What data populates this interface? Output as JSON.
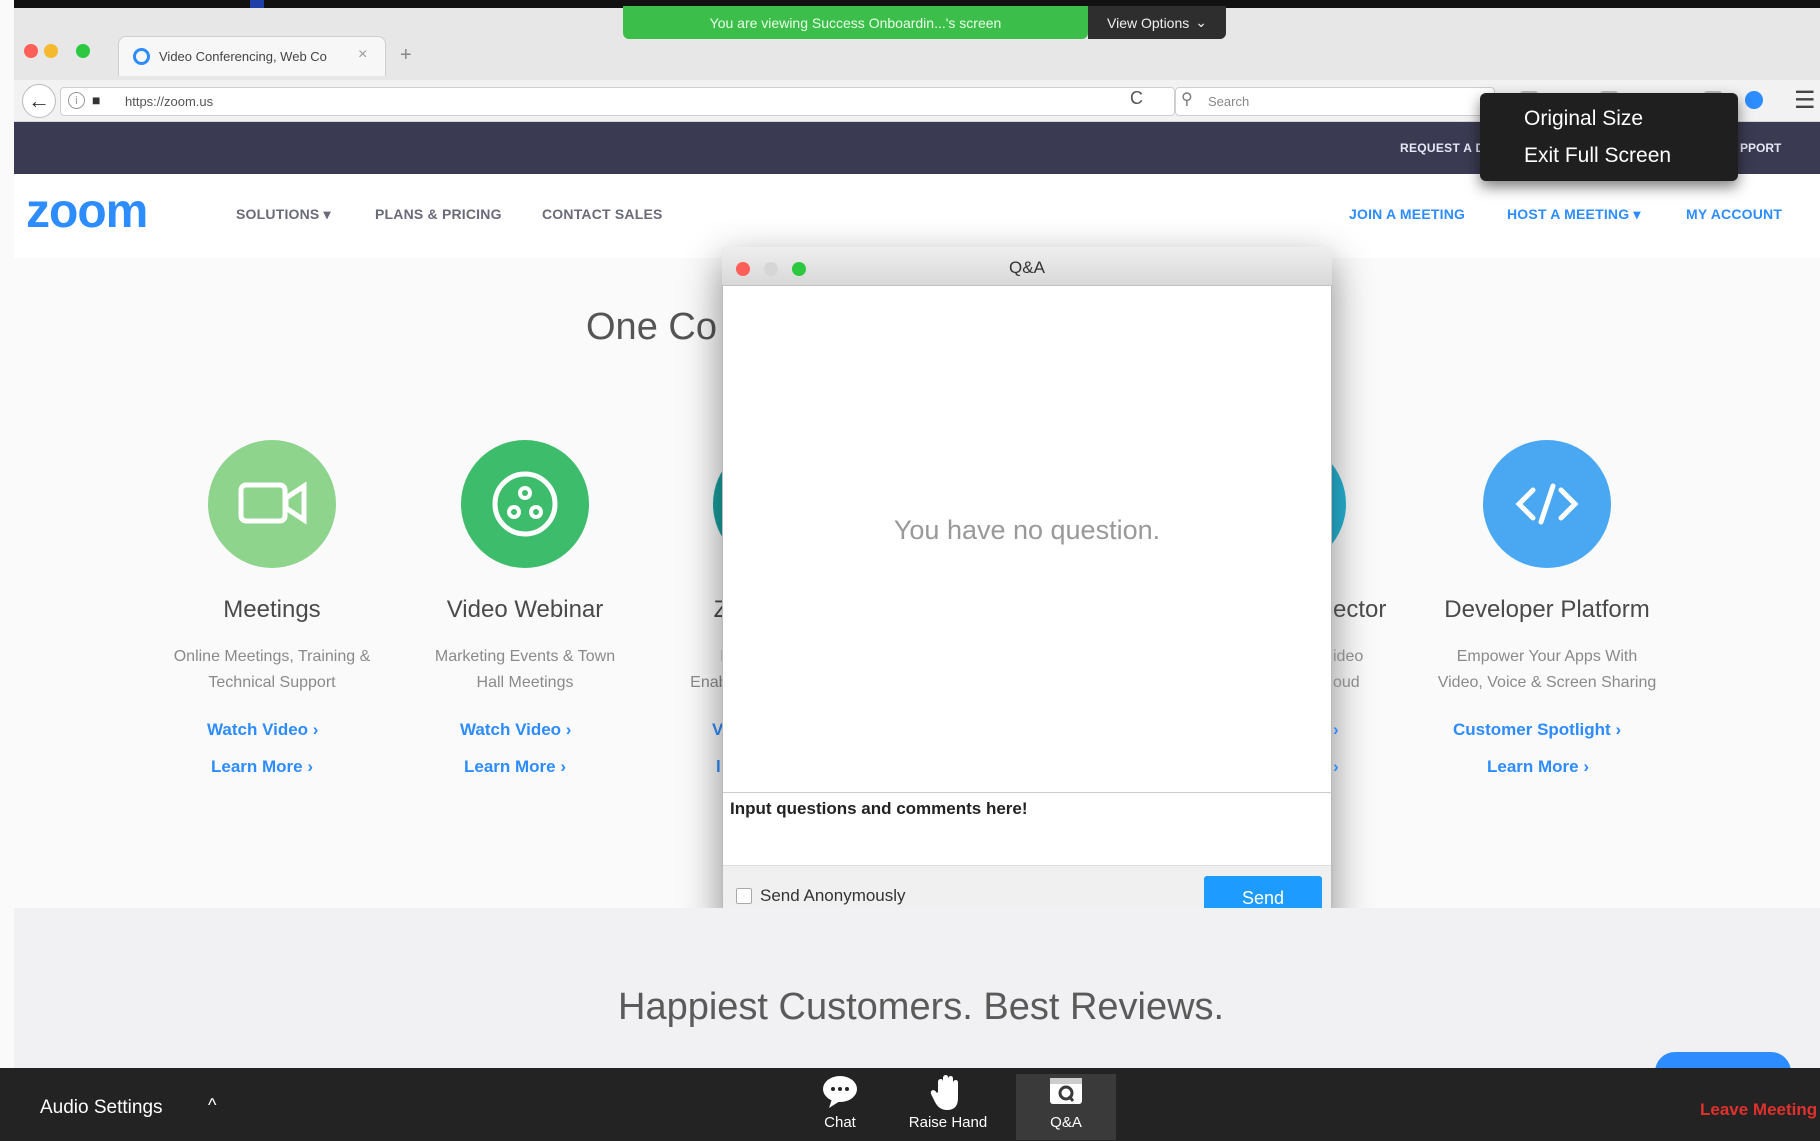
{
  "share": {
    "banner_text": "You are viewing Success Onboardin...'s screen",
    "view_options_label": "View Options",
    "caret": "⌄"
  },
  "browser": {
    "tab_title": "Video Conferencing, Web Co",
    "tab_close": "×",
    "new_tab": "+",
    "url": "https://zoom.us",
    "search_placeholder": "Search",
    "menu_glyph": "☰",
    "back_glyph": "←",
    "reload_glyph": "C",
    "info_glyph": "i",
    "lock_glyph": "🔒",
    "search_glyph": "⚲"
  },
  "fullscreen_menu": {
    "items": [
      "Original Size",
      "Exit Full Screen"
    ]
  },
  "site": {
    "topbar": {
      "request_demo": "REQUEST A D",
      "support": "PPORT"
    },
    "logo": "zoom",
    "nav_left": [
      "SOLUTIONS ▾",
      "PLANS & PRICING",
      "CONTACT SALES"
    ],
    "nav_right": [
      "JOIN A MEETING",
      "HOST A MEETING ▾",
      "MY ACCOUNT"
    ],
    "section_title": "One Co",
    "products": [
      {
        "title": "Meetings",
        "desc1": "Online Meetings, Training &",
        "desc2": "Technical Support",
        "link1": "Watch Video  ›",
        "link2": "Learn More  ›",
        "color": "#8fd48c"
      },
      {
        "title": "Video Webinar",
        "desc1": "Marketing Events & Town",
        "desc2": "Hall Meetings",
        "link1": "Watch Video  ›",
        "link2": "Learn More  ›",
        "color": "#3dbd6b"
      },
      {
        "title": "Z",
        "desc1": "Bu",
        "desc2": "Enable",
        "link1": "V",
        "link2": "l",
        "color": "#1aa0a0"
      },
      {
        "title": "ector",
        "desc1": "ideo",
        "desc2": "oud",
        "link1": "›",
        "link2": "›",
        "color": "#27b5d6"
      },
      {
        "title": "Developer Platform",
        "desc1": "Empower Your Apps With",
        "desc2": "Video, Voice & Screen Sharing",
        "link1": "Customer Spotlight  ›",
        "link2": "Learn More  ›",
        "color": "#4aa8f2"
      }
    ],
    "lower_title": "Happiest Customers. Best Reviews."
  },
  "qa": {
    "title": "Q&A",
    "empty_text": "You have no question.",
    "input_placeholder": "Input questions and comments here!",
    "anonymous_label": "Send Anonymously",
    "send_label": "Send"
  },
  "meeting_bar": {
    "audio_settings": "Audio Settings",
    "audio_caret": "^",
    "tools": [
      {
        "label": "Chat",
        "glyph": "💬"
      },
      {
        "label": "Raise Hand",
        "glyph": "✋"
      },
      {
        "label": "Q&A",
        "glyph": "▣"
      }
    ],
    "leave": "Leave Meeting"
  },
  "colors": {
    "zoom_blue": "#2d8cff",
    "banner_green": "#3cbf4a",
    "leave_red": "#e0312d"
  }
}
